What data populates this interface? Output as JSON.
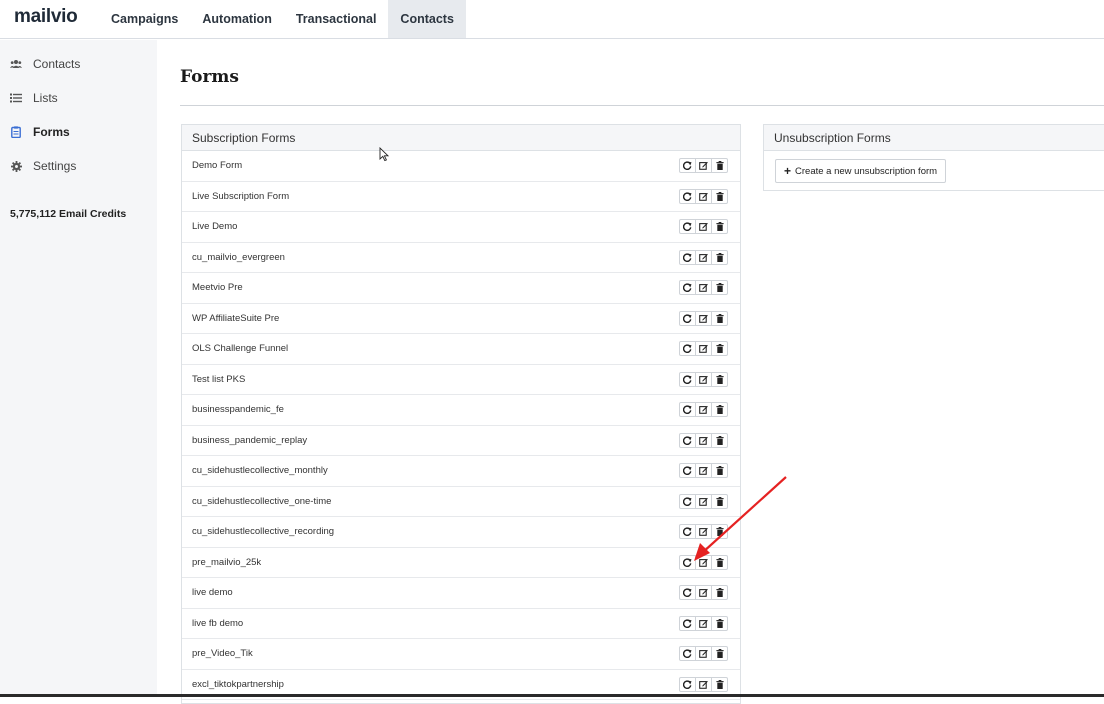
{
  "app": {
    "logo": "mailvio"
  },
  "nav": [
    {
      "label": "Campaigns",
      "active": false
    },
    {
      "label": "Automation",
      "active": false
    },
    {
      "label": "Transactional",
      "active": false
    },
    {
      "label": "Contacts",
      "active": true
    }
  ],
  "sidebar": {
    "items": [
      {
        "label": "Contacts",
        "icon": "users-icon",
        "active": false
      },
      {
        "label": "Lists",
        "icon": "list-icon",
        "active": false
      },
      {
        "label": "Forms",
        "icon": "clipboard-icon",
        "active": true
      },
      {
        "label": "Settings",
        "icon": "gear-icon",
        "active": false
      }
    ],
    "credits": "5,775,112 Email Credits"
  },
  "page": {
    "title": "Forms"
  },
  "subscription": {
    "heading": "Subscription Forms",
    "forms": [
      "Demo Form",
      "Live Subscription Form",
      "Live Demo",
      "cu_mailvio_evergreen",
      "Meetvio Pre",
      "WP AffiliateSuite Pre",
      "OLS Challenge Funnel",
      "Test list PKS",
      "businesspandemic_fe",
      "business_pandemic_replay",
      "cu_sidehustlecollective_monthly",
      "cu_sidehustlecollective_one-time",
      "cu_sidehustlecollective_recording",
      "pre_mailvio_25k",
      "live demo",
      "live fb demo",
      "pre_Video_Tik",
      "excl_tiktokpartnership"
    ],
    "row_actions": [
      "share-icon",
      "edit-icon",
      "trash-icon"
    ]
  },
  "unsubscription": {
    "heading": "Unsubscription Forms",
    "create_label": "Create a new unsubscription form"
  },
  "colors": {
    "annotation_arrow": "#e52222",
    "active_nav_bg": "#e7eaee",
    "sidebar_bg": "#f5f6f8"
  }
}
